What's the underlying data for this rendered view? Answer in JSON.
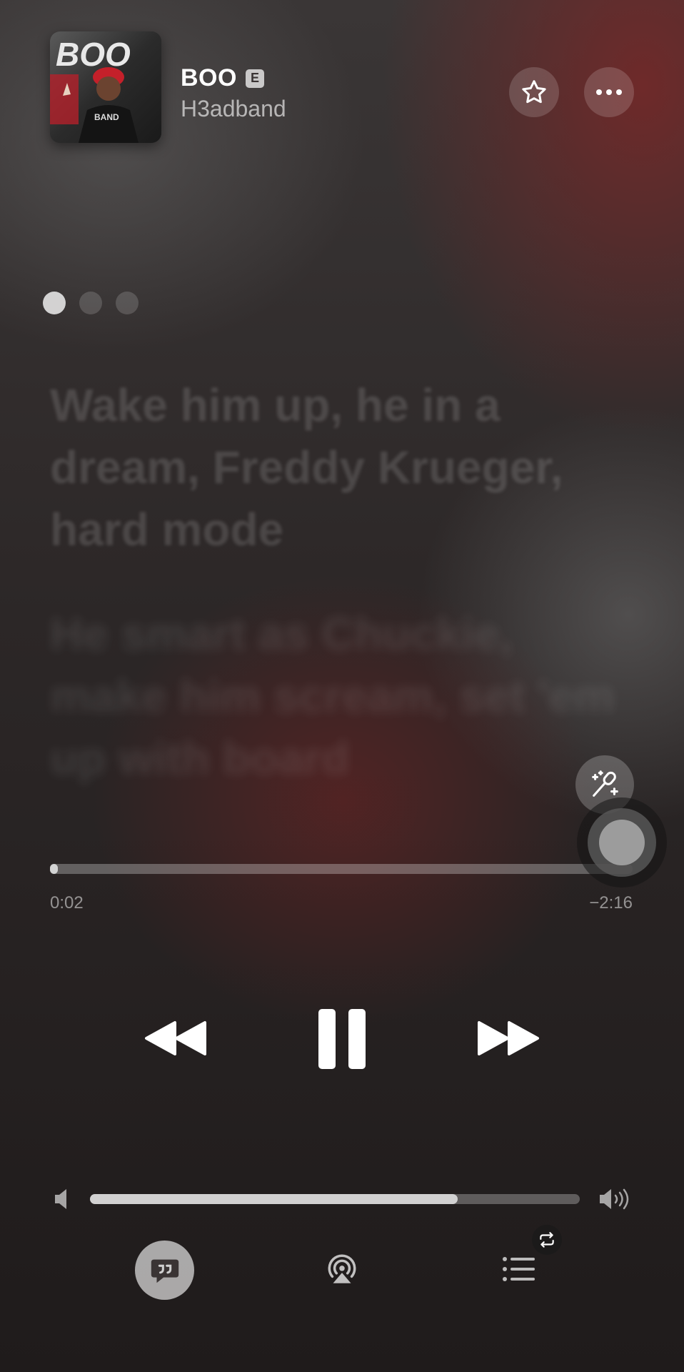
{
  "now_playing": {
    "title": "BOO",
    "explicit_badge": "E",
    "artist": "H3adband",
    "artwork": {
      "text_top": "BOO",
      "text_shirt": "BAND",
      "accent_color": "#c4202a"
    }
  },
  "pager": {
    "count": 3,
    "active_index": 0
  },
  "lyrics": {
    "current_line": "Wake him up, he in a dream, Freddy Krueger, hard mode",
    "next_line": "He smart as Chuckie, make him scream, set 'em up with board"
  },
  "progress": {
    "elapsed": "0:02",
    "remaining": "−2:16",
    "fraction": 0.014
  },
  "volume": {
    "fraction": 0.75
  },
  "icons": {
    "favorite": "star-icon",
    "more": "ellipsis-icon",
    "sing": "microphone-sparkle-icon",
    "rewind": "rewind-icon",
    "pause": "pause-icon",
    "forward": "fast-forward-icon",
    "volume_low": "speaker-low-icon",
    "volume_high": "speaker-high-icon",
    "lyrics": "lyrics-quote-icon",
    "airplay": "airplay-icon",
    "queue": "queue-list-icon",
    "repeat": "repeat-icon"
  }
}
